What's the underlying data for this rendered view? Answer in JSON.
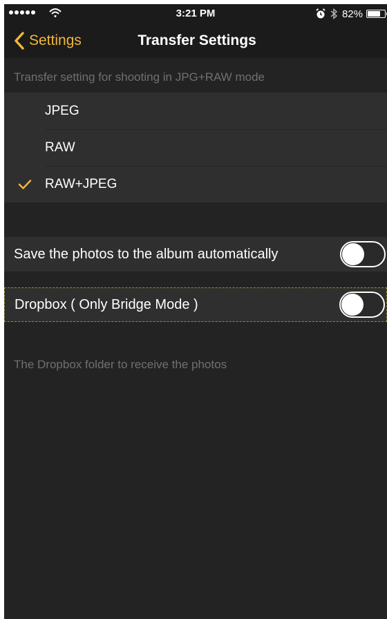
{
  "status_bar": {
    "time": "3:21 PM",
    "battery_percent": "82%",
    "battery_level": 0.82,
    "icons": [
      "signal-dots-icon",
      "wifi-icon",
      "alarm-icon",
      "bluetooth-icon",
      "battery-icon"
    ]
  },
  "nav": {
    "back_label": "Settings",
    "title": "Transfer Settings"
  },
  "transfer_section": {
    "header": "Transfer setting for shooting in JPG+RAW mode",
    "options": [
      {
        "label": "JPEG",
        "selected": false
      },
      {
        "label": "RAW",
        "selected": false
      },
      {
        "label": "RAW+JPEG",
        "selected": true
      }
    ]
  },
  "auto_save": {
    "label": "Save the photos to the album automatically",
    "on": false
  },
  "dropbox": {
    "label": "Dropbox ( Only Bridge Mode )",
    "on": false,
    "footer": "The Dropbox folder to receive the photos"
  },
  "colors": {
    "accent": "#f0b73c",
    "background": "#232323",
    "bar": "#1b1b1b",
    "cell": "#2f2f2f",
    "secondary_text": "#707070"
  }
}
